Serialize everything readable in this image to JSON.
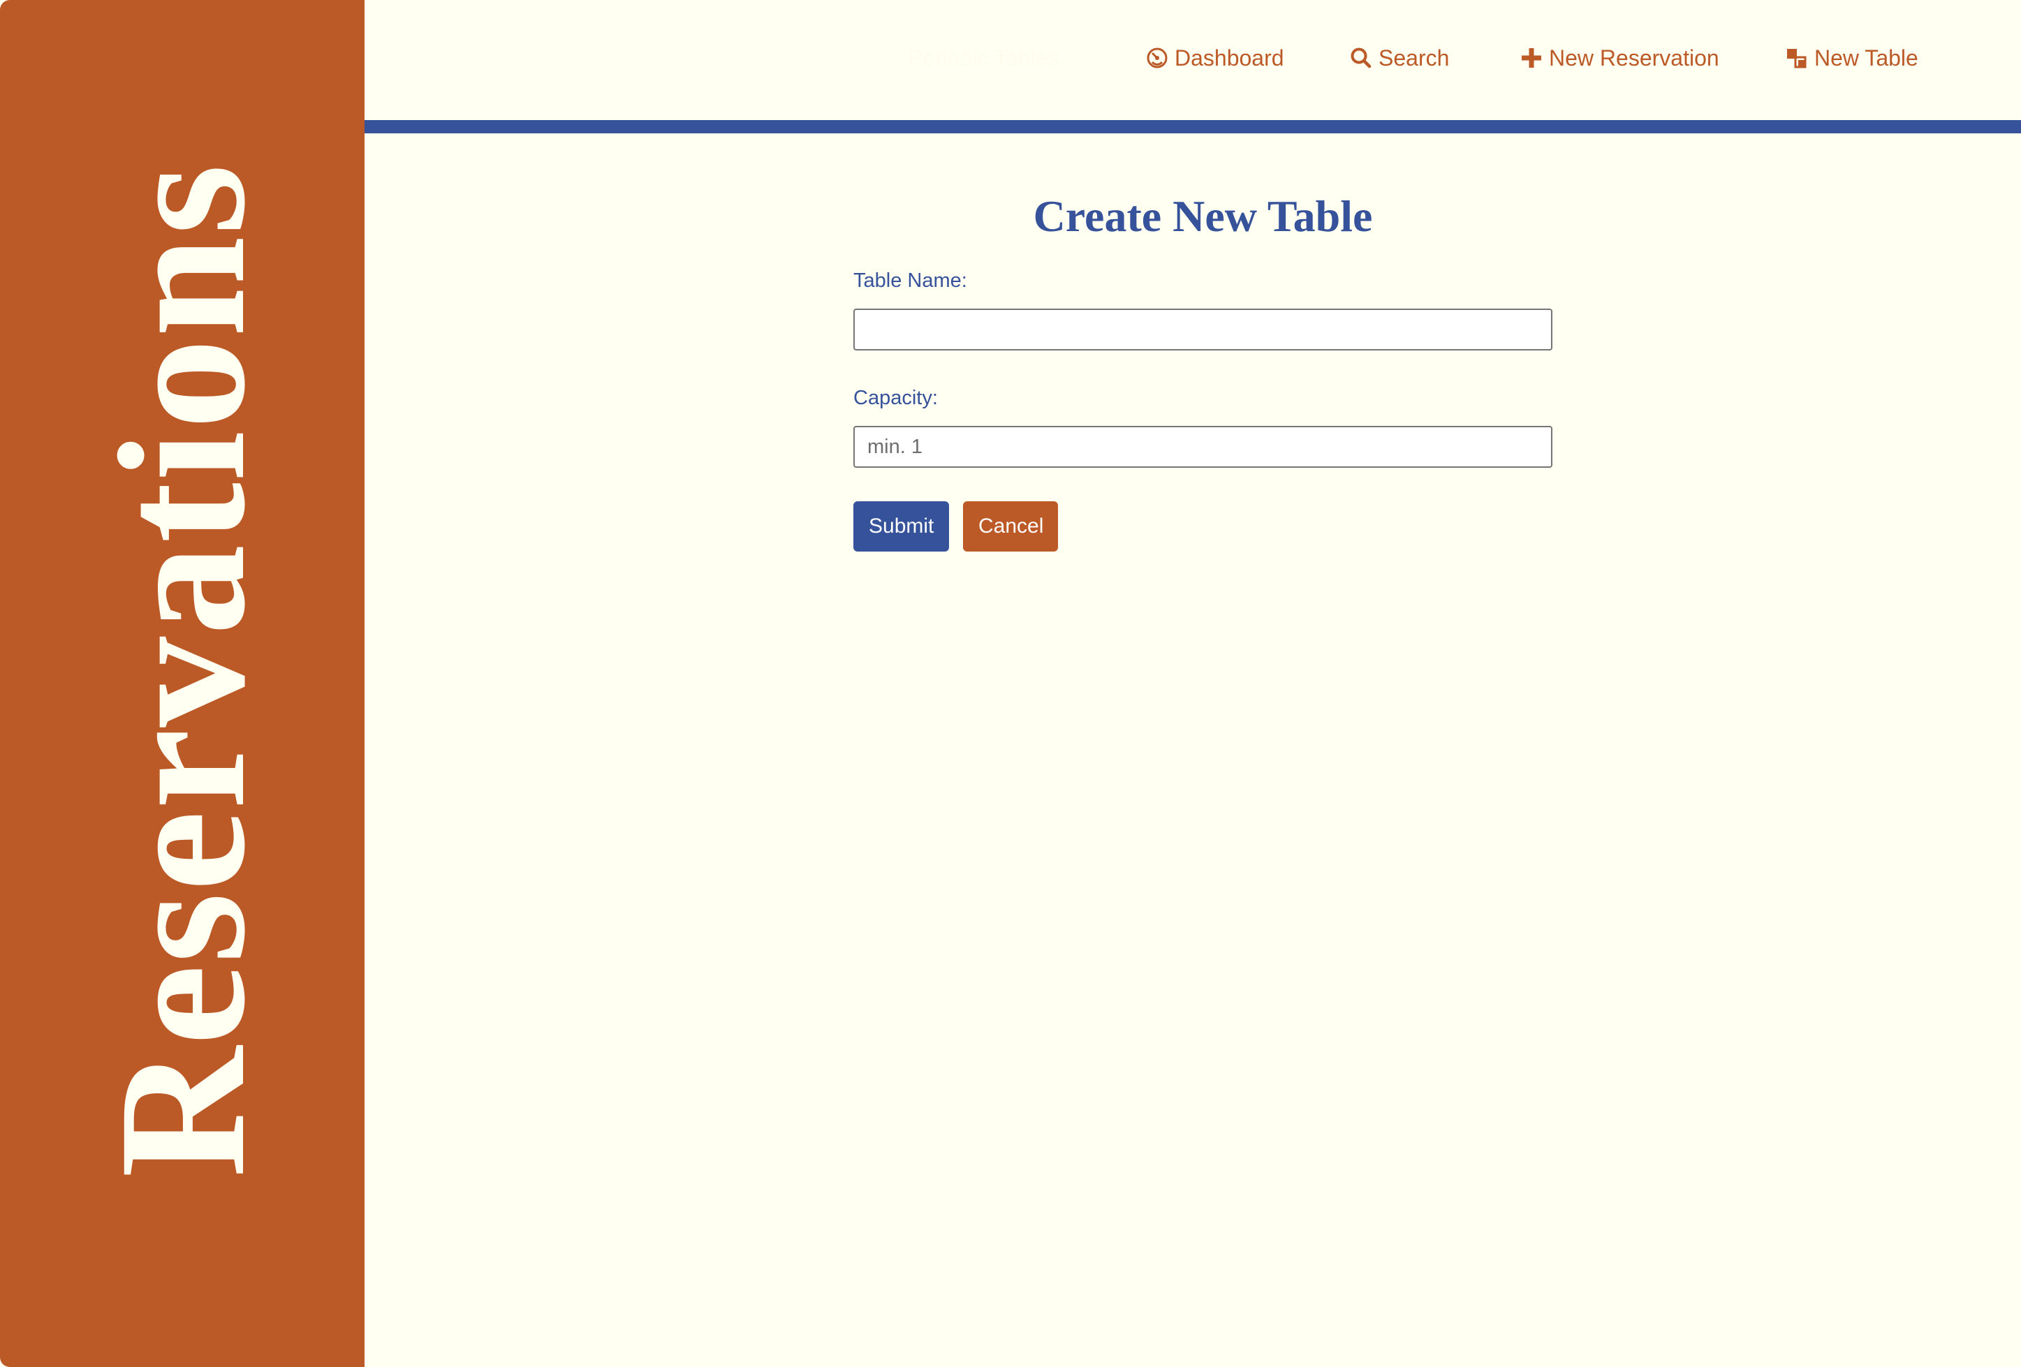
{
  "sidebar": {
    "title": "Reservations"
  },
  "nav": {
    "items": [
      {
        "label": "Periodic Tables",
        "icon": "table-icon"
      },
      {
        "label": "Dashboard",
        "icon": "dashboard-icon"
      },
      {
        "label": "Search",
        "icon": "search-icon"
      },
      {
        "label": "New Reservation",
        "icon": "plus-icon"
      },
      {
        "label": "New Table",
        "icon": "new-table-icon"
      }
    ]
  },
  "form": {
    "title": "Create New Table",
    "table_name_label": "Table Name:",
    "table_name_value": "",
    "table_name_placeholder": "",
    "capacity_label": "Capacity:",
    "capacity_value": "",
    "capacity_placeholder": "min. 1",
    "submit_label": "Submit",
    "cancel_label": "Cancel"
  },
  "colors": {
    "background": "#fffff2",
    "accent_orange": "#bc5a27",
    "accent_blue": "#35529a"
  }
}
